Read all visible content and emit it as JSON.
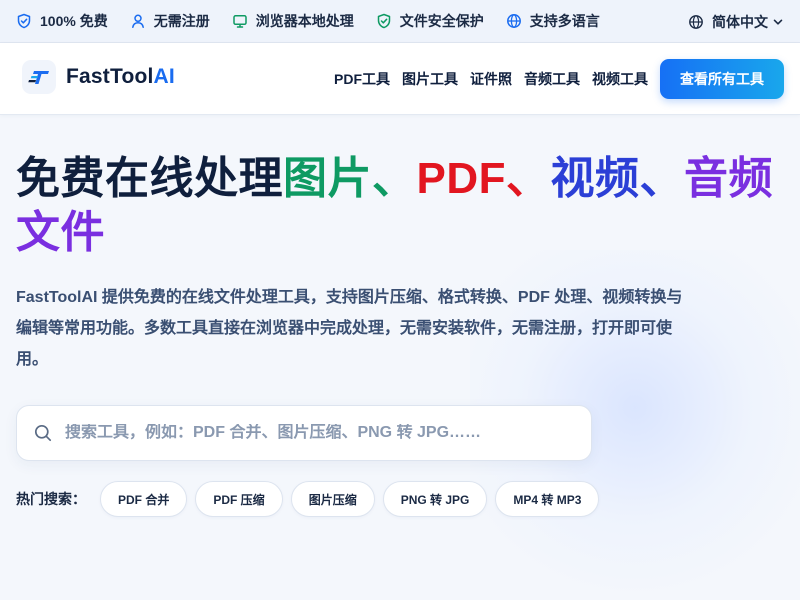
{
  "topbar": {
    "items": [
      {
        "icon": "shield-check-icon",
        "label": "100% 免费"
      },
      {
        "icon": "user-icon",
        "label": "无需注册"
      },
      {
        "icon": "monitor-icon",
        "label": "浏览器本地处理"
      },
      {
        "icon": "shield-check-icon",
        "label": "文件安全保护"
      },
      {
        "icon": "globe-icon",
        "label": "支持多语言"
      }
    ],
    "language": "简体中文"
  },
  "nav": {
    "logo_main": "FastTool",
    "logo_accent": "AI",
    "links": [
      "PDF工具",
      "图片工具",
      "证件照",
      "音频工具",
      "视频工具"
    ],
    "cta": "查看所有工具"
  },
  "hero": {
    "title_prefix": "免费在线处理",
    "title_images": "图片",
    "sep1": "、",
    "title_pdf": "PDF",
    "sep2": "、",
    "title_video": "视频",
    "sep3": "、",
    "title_audio_files": "音频文件",
    "description": "FastToolAI 提供免费的在线文件处理工具，支持图片压缩、格式转换、PDF 处理、视频转换与编辑等常用功能。多数工具直接在浏览器中完成处理，无需安装软件，无需注册，打开即可使用。"
  },
  "search": {
    "placeholder": "搜索工具，例如：PDF 合并、图片压缩、PNG 转 JPG……",
    "value": ""
  },
  "hot": {
    "label": "热门搜索：",
    "chips": [
      "PDF 合并",
      "PDF 压缩",
      "图片压缩",
      "PNG 转 JPG",
      "MP4 转 MP3"
    ]
  },
  "colors": {
    "accent": "#1670f5",
    "green": "#0e9a63",
    "red": "#e21620",
    "blue": "#2b3fd6",
    "purple": "#7a2fe0"
  }
}
